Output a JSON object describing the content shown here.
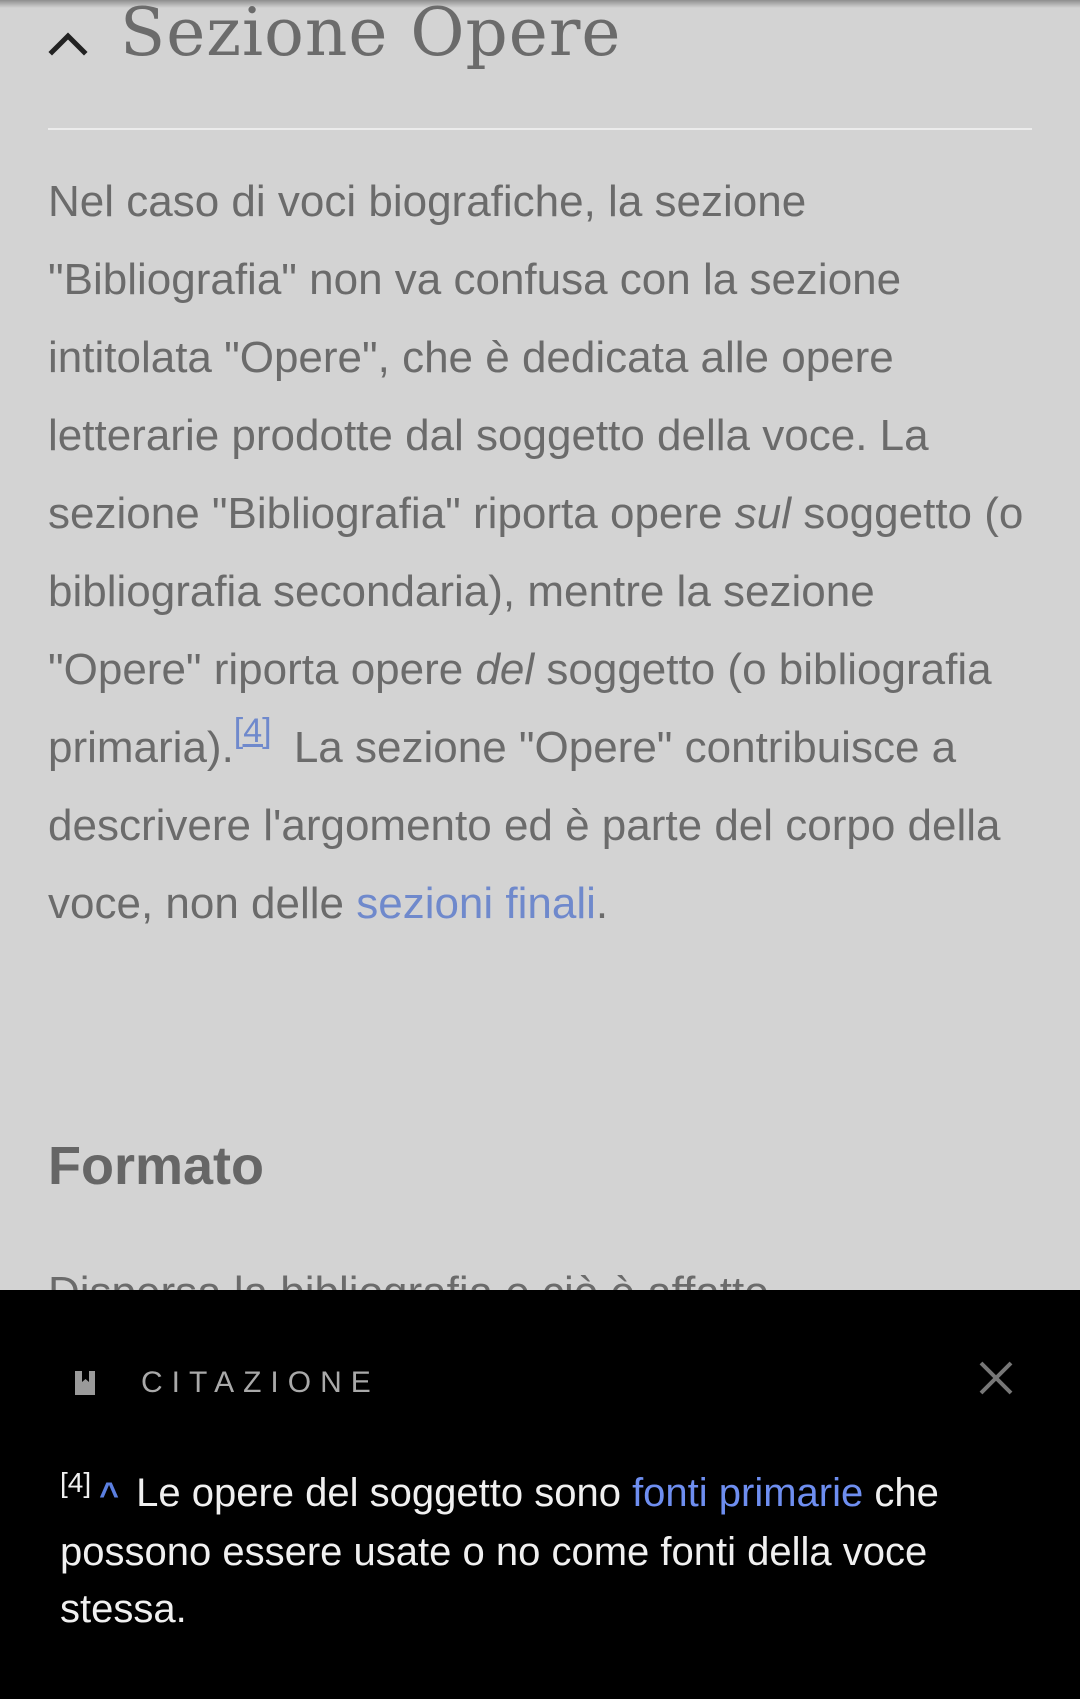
{
  "section": {
    "title": "Sezione Opere"
  },
  "paragraph": {
    "t1": "Nel caso di voci biografiche, la sezione \"Bibliografia\" non va confusa con la sezione intitolata \"Opere\", che è dedicata alle opere letterarie prodotte dal soggetto della voce. La sezione \"Bibliografia\" riporta opere ",
    "em1": "sul",
    "t2": " soggetto (o bibliografia secondaria), mentre la sezione \"Opere\" riporta opere ",
    "em2": "del",
    "t3": " soggetto (o bibliografia primaria).",
    "ref": "[4]",
    "t4": " La sezione \"Opere\" contribuisce a descrivere l'argomento ed è parte del corpo della voce, non delle ",
    "link": "sezioni finali",
    "t5": "."
  },
  "subheading": "Formato",
  "peek_text": "Dispersa la bibliografia e ciò è affatto",
  "citation_sheet": {
    "title": "CITAZIONE",
    "icon": "bookmark-icon",
    "close_icon": "close-icon",
    "ref_number": "[4]",
    "caret": "^",
    "text_before": " Le opere del soggetto sono ",
    "link": "fonti primarie",
    "text_after": " che possono essere usate o no come fonti della voce stessa."
  },
  "colors": {
    "background_dimmed": "#d3d3d3",
    "link": "#6f89cc",
    "sheet_background": "#000000",
    "sheet_link": "#6e8ef0"
  }
}
